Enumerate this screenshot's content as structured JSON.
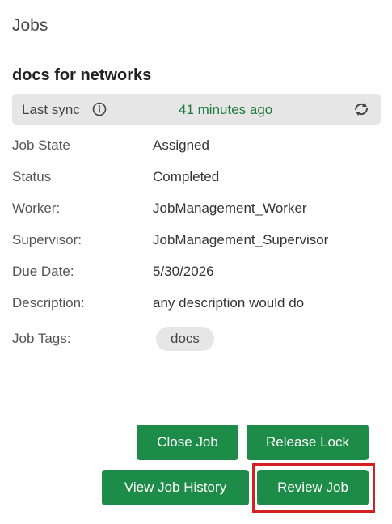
{
  "header": {
    "title": "Jobs"
  },
  "job": {
    "title": "docs for networks"
  },
  "sync": {
    "label": "Last sync",
    "time": "41 minutes ago",
    "info_icon": "info-icon",
    "refresh_icon": "refresh-icon"
  },
  "details": [
    {
      "label": "Job State",
      "value": "Assigned"
    },
    {
      "label": "Status",
      "value": "Completed"
    },
    {
      "label": "Worker:",
      "value": "JobManagement_Worker"
    },
    {
      "label": "Supervisor:",
      "value": "JobManagement_Supervisor"
    },
    {
      "label": "Due Date:",
      "value": "5/30/2026"
    },
    {
      "label": "Description:",
      "value": "any description would do"
    }
  ],
  "tags": {
    "label": "Job Tags:",
    "items": [
      "docs"
    ]
  },
  "actions": {
    "close_job": "Close Job",
    "release_lock": "Release Lock",
    "view_history": "View Job History",
    "review_job": "Review Job"
  },
  "colors": {
    "accent": "#1e8c49",
    "sync_time": "#1f7a3f",
    "highlight": "#d42020",
    "bar_bg": "#e6e6e6"
  }
}
